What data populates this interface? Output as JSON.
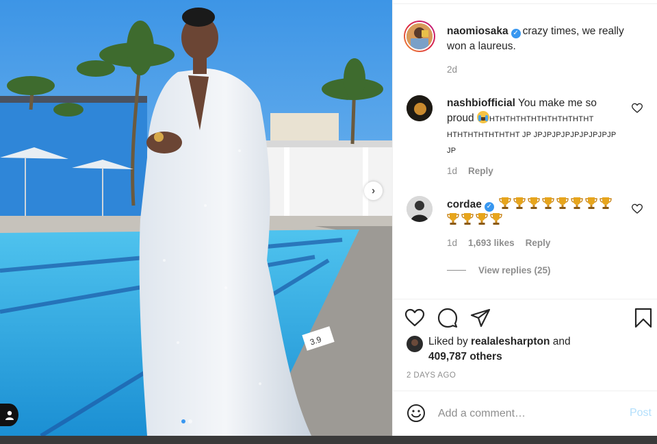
{
  "post": {
    "author": "naomiosaka",
    "caption": "crazy times, we really won a laureus.",
    "caption_line1": "crazy times, we really",
    "caption_line2": "won a laureus.",
    "age": "2d"
  },
  "comments": [
    {
      "user": "nashbiofficial",
      "line1": "You make me so",
      "line2_prefix": "proud ",
      "line2_rest": "HTHTHTHTHTHTHTHTHTHT",
      "line3": "HTHTHTHTHTHTHT JP JPJPJPJPJPJPJPJPJP",
      "line4": "JP",
      "age": "1d",
      "reply_label": "Reply"
    },
    {
      "user": "cordae",
      "trophies_line1": 8,
      "trophies_line2": 4,
      "age": "1d",
      "likes": "1,693 likes",
      "reply_label": "Reply",
      "view_replies": "View replies (25)"
    }
  ],
  "engagement": {
    "liked_by_prefix": "Liked by",
    "liked_by_user": "realalesharpton",
    "liked_by_and": "and",
    "others": "409,787 others",
    "date": "2 DAYS AGO"
  },
  "add_comment": {
    "placeholder": "Add a comment…",
    "post_label": "Post"
  },
  "icons": [
    "heart-icon",
    "comment-icon",
    "share-icon",
    "bookmark-icon",
    "emoji-icon",
    "chevron-right-icon",
    "user-tag-icon",
    "verified-badge-icon",
    "trophy-icon"
  ],
  "colors": {
    "verified": "#3897f0",
    "post_disabled": "#b2dffc",
    "muted": "#8e8e8e",
    "text": "#262626"
  }
}
